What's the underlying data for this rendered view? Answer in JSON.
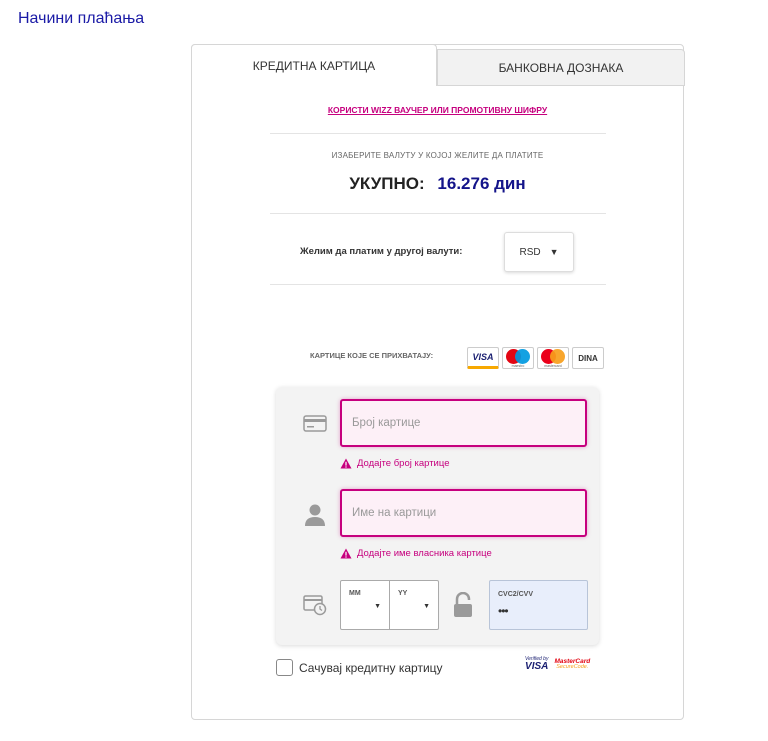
{
  "page": {
    "title": "Начини плаћања"
  },
  "tabs": [
    {
      "label": "КРЕДИТНА КАРТИЦА",
      "active": true
    },
    {
      "label": "БАНКОВНА ДОЗНАКА",
      "active": false
    }
  ],
  "voucher_link": "КОРИСТИ WIZZ ВАУЧЕР ИЛИ ПРОМОТИВНУ ШИФРУ",
  "currency_caption": "ИЗАБЕРИТЕ ВАЛУТУ У КОЈОЈ ЖЕЛИТЕ ДА ПЛАТИТЕ",
  "total": {
    "label": "УКУПНО:",
    "value": "16.276 дин"
  },
  "other_currency": {
    "label": "Желим да платим у другој валути:",
    "selected": "RSD"
  },
  "accepted_cards": {
    "label": "КАРТИЦЕ КОЈЕ СЕ ПРИХВАТАЈУ:",
    "logos": [
      {
        "text": "VISA",
        "icon": "visa-logo-icon"
      },
      {
        "sub": "maestro",
        "icon": "maestro-logo-icon"
      },
      {
        "sub": "mastercard",
        "icon": "mastercard-logo-icon"
      },
      {
        "text": "DINA",
        "icon": "dina-logo-icon"
      }
    ]
  },
  "form": {
    "card_number": {
      "placeholder": "Број картице",
      "error": "Додајте број картице",
      "icon": "credit-card-icon"
    },
    "card_name": {
      "placeholder": "Име на картици",
      "error": "Додајте име власника картице",
      "icon": "user-icon"
    },
    "expiry": {
      "month_label": "MM",
      "year_label": "YY",
      "icon": "calendar-clock-icon"
    },
    "cvc": {
      "label": "CVC2/CVV",
      "value": "•••",
      "icon": "unlock-icon"
    }
  },
  "save_card_label": "Сачувај кредитну картицу",
  "secure": {
    "vbv_top": "Verified by",
    "vbv_main": "VISA",
    "mc_top": "MasterCard",
    "mc_bottom": "SecureCode."
  },
  "colors": {
    "accent": "#c6007e",
    "title_blue": "#1a1aa6",
    "total_blue": "#14148a",
    "error": "#c6007e"
  }
}
